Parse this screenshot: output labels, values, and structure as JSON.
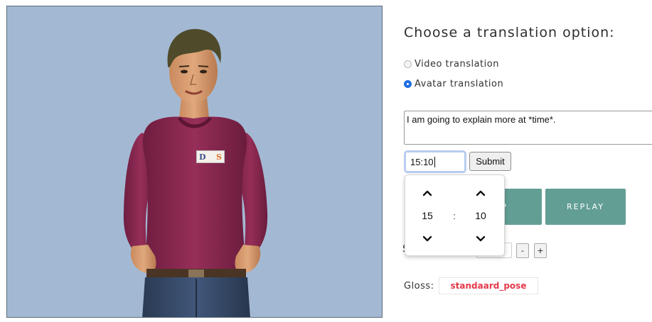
{
  "translation_options": {
    "heading": "Choose a translation option:",
    "video_label": "Video translation",
    "avatar_label": "Avatar translation",
    "selected": "avatar"
  },
  "sentence_input": {
    "value": "I am going to explain more at *time*."
  },
  "time_input": {
    "value": "15:10"
  },
  "submit_label": "Submit",
  "time_picker": {
    "hour": "15",
    "minute": "10",
    "separator": ":",
    "icons": [
      "chevron-up-icon",
      "chevron-down-icon"
    ]
  },
  "controls": {
    "stop_label": "TOP",
    "replay_label": "REPLAY",
    "speed_label": "S",
    "minus_label": "-",
    "plus_label": "+"
  },
  "gloss": {
    "label": "Gloss:",
    "value": "standaard_pose"
  },
  "badge": {
    "text_left": "D",
    "text_right": "S"
  },
  "colors": {
    "viewport_bg": "#a3b9d3",
    "accent_teal": "#639e95",
    "gloss_red": "#e5384a",
    "radio_blue": "#1e6fe0",
    "shirt": "#8d2c52"
  }
}
